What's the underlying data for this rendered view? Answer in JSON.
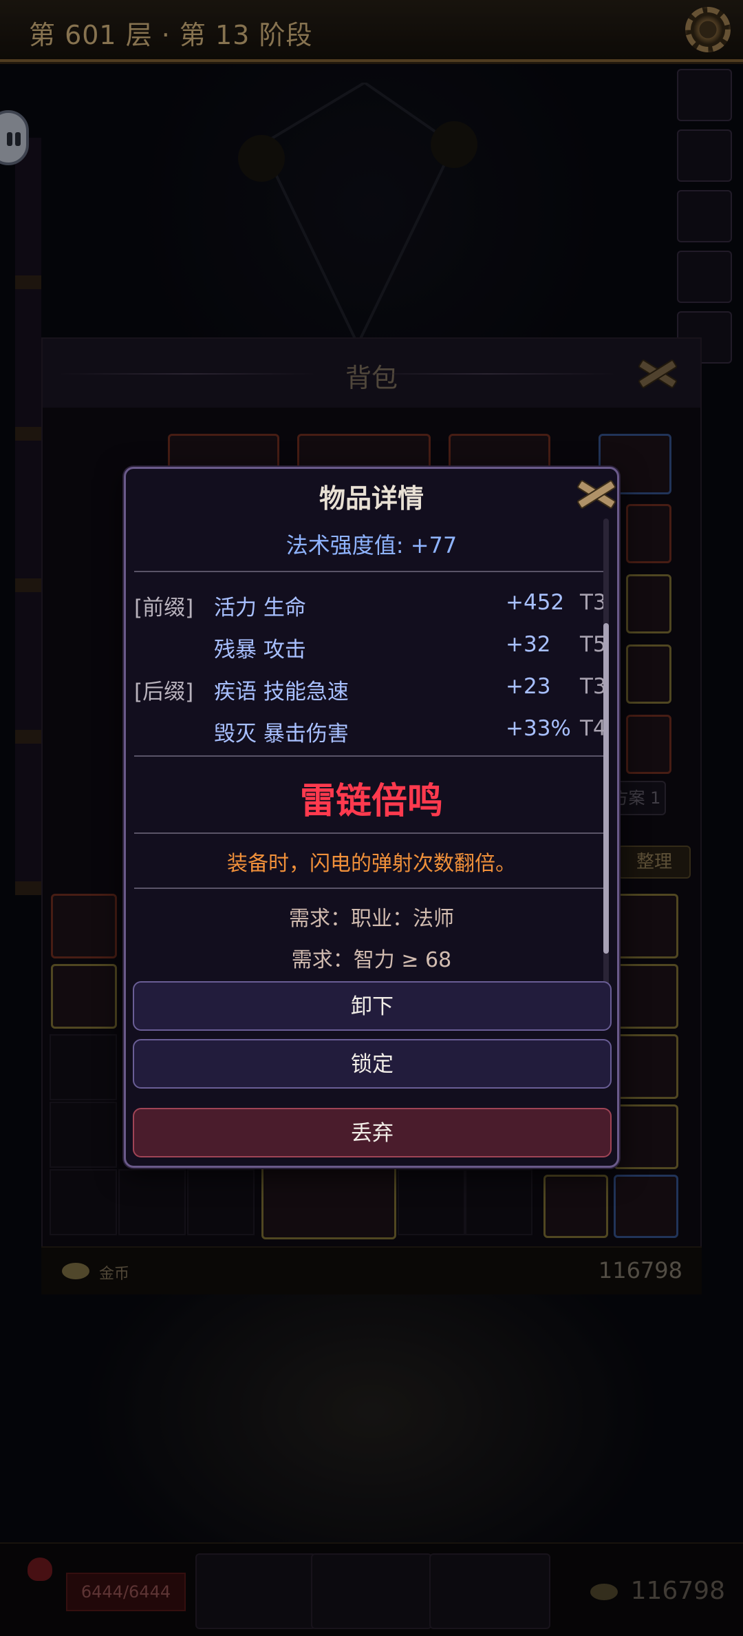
{
  "header": {
    "title": "第 601 层 · 第 13 阶段"
  },
  "bag": {
    "title": "背包",
    "plan_label": "方案 1",
    "sort_label": "整理",
    "gold_label": "金币",
    "gold_value": "116798"
  },
  "bottom_bar": {
    "hp": "6444/6444",
    "gold": "116798"
  },
  "item_detail": {
    "title": "物品详情",
    "spell_power": "法术强度值: +77",
    "affixes": [
      {
        "tag": "[前缀]",
        "name": "活力 生命",
        "value": "+452",
        "tier": "T3"
      },
      {
        "tag": "",
        "name": "残暴 攻击",
        "value": "+32",
        "tier": "T5"
      },
      {
        "tag": "[后缀]",
        "name": "疾语 技能急速",
        "value": "+23",
        "tier": "T3"
      },
      {
        "tag": "",
        "name": "毁灭 暴击伤害",
        "value": "+33%",
        "tier": "T4"
      }
    ],
    "unique_name": "雷链倍鸣",
    "unique_effect": "装备时，闪电的弹射次数翻倍。",
    "requirements": [
      "需求：职业：法师",
      "需求：智力 ≥ 68"
    ],
    "buttons": {
      "unequip": "卸下",
      "lock": "锁定",
      "discard": "丢弃"
    }
  },
  "colors": {
    "unique": "#ff3a4e",
    "affix": "#a8c0ff",
    "effect": "#f0903a",
    "discard": "#4a1c2c"
  }
}
